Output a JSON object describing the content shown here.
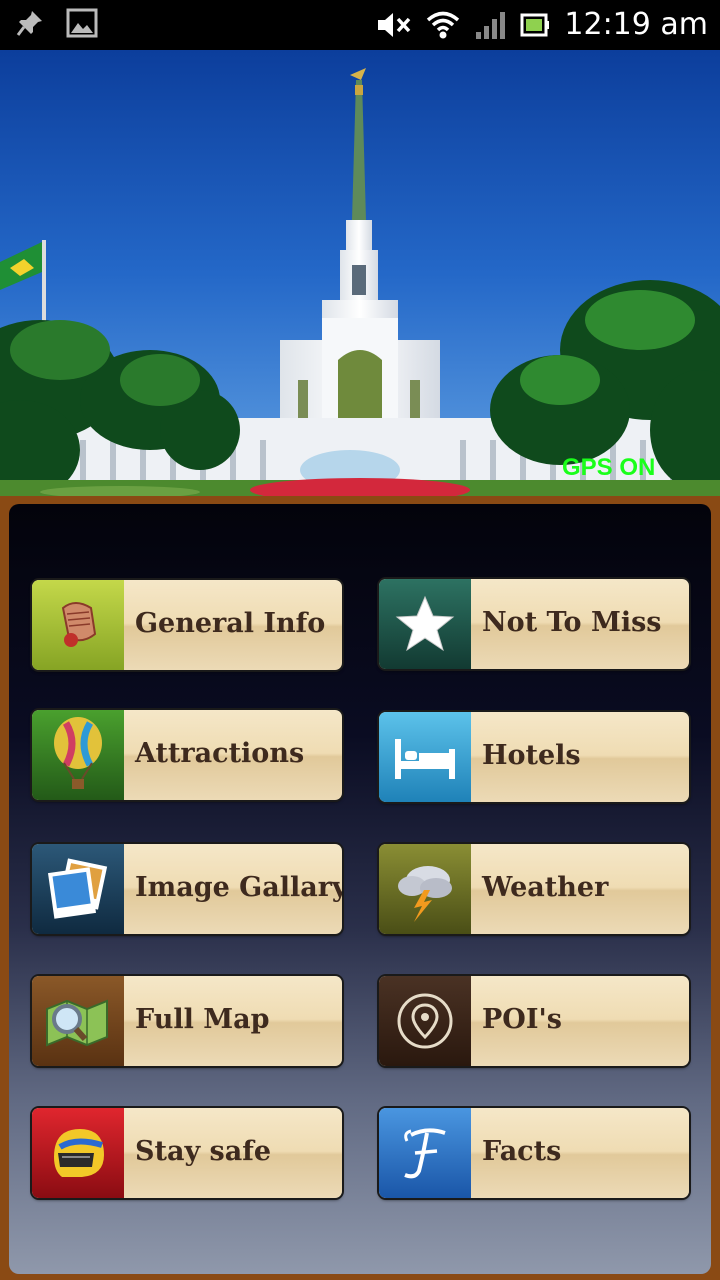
{
  "status_bar": {
    "time": "12:19 am"
  },
  "hero": {
    "gps_status": "GPS ON"
  },
  "menu": [
    {
      "label": "General Info",
      "icon": "scroll-icon",
      "color": "#a8c030"
    },
    {
      "label": "Not To Miss",
      "icon": "star-icon",
      "color": "#1f5a4c"
    },
    {
      "label": "Attractions",
      "icon": "hot-air-balloon-icon",
      "color": "#3e8c24"
    },
    {
      "label": "Hotels",
      "icon": "bed-icon",
      "color": "#35a8d8"
    },
    {
      "label": "Image Gallary",
      "icon": "photos-icon",
      "color": "#1c3e5a"
    },
    {
      "label": "Weather",
      "icon": "storm-cloud-icon",
      "color": "#6f7426"
    },
    {
      "label": "Full Map",
      "icon": "map-icon",
      "color": "#7a4a1c"
    },
    {
      "label": "POI's",
      "icon": "location-pin-icon",
      "color": "#3a2418"
    },
    {
      "label": "Stay safe",
      "icon": "helmet-icon",
      "color": "#c8161e"
    },
    {
      "label": "Facts",
      "icon": "letter-f-icon",
      "color": "#2e76c8"
    }
  ]
}
